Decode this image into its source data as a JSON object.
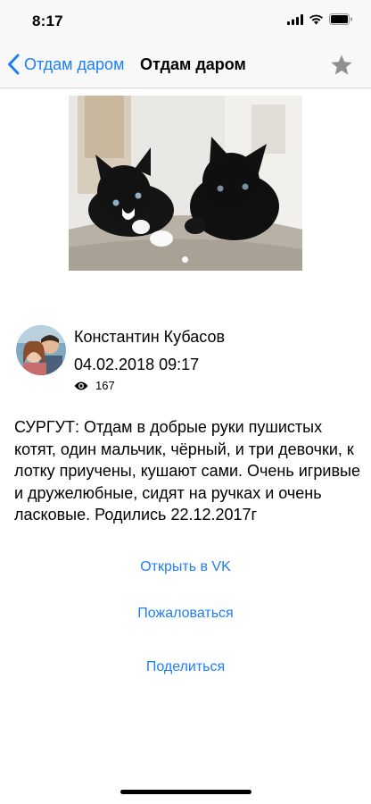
{
  "status_bar": {
    "time": "8:17"
  },
  "nav": {
    "back_label": "Отдам даром",
    "title": "Отдам даром"
  },
  "gallery": {
    "current_page": 1,
    "total_pages": 1
  },
  "post": {
    "author": "Константин Кубасов",
    "date": "04.02.2018 09:17",
    "views": "167",
    "text": "СУРГУТ: Отдам в добрые руки пушистых котят, один мальчик, чёрный, и три девочки, к лотку приучены, кушают сами. Очень игривые и дружелюбные, сидят на ручках и очень ласковые. Родились 22.12.2017г"
  },
  "actions": {
    "open_vk": "Открыть в VK",
    "report": "Пожаловаться",
    "share": "Поделиться"
  },
  "colors": {
    "accent": "#1e7ff3",
    "bar_background": "#f8f8f8"
  }
}
